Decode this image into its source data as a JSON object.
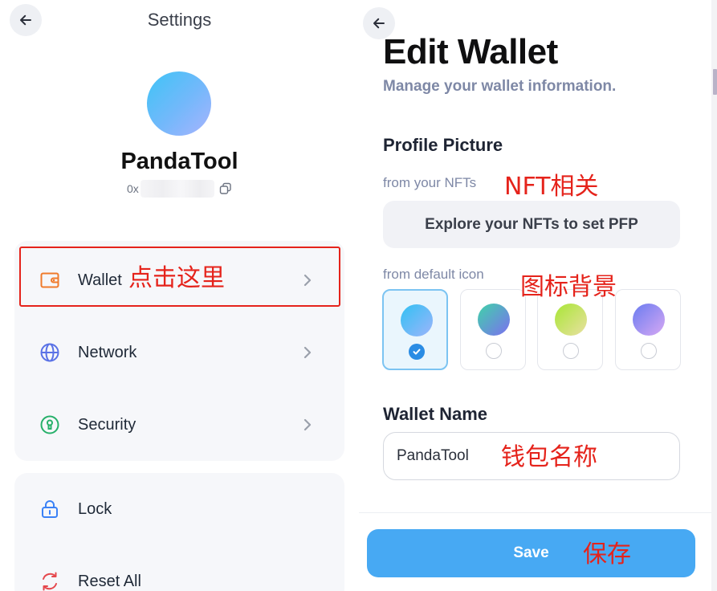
{
  "settings": {
    "title": "Settings",
    "profile": {
      "name": "PandaTool",
      "address_prefix": "0x"
    },
    "menu_group_1": [
      {
        "label": "Wallet",
        "icon": "wallet-icon"
      },
      {
        "label": "Network",
        "icon": "globe-icon"
      },
      {
        "label": "Security",
        "icon": "keyhole-icon"
      }
    ],
    "menu_group_2": [
      {
        "label": "Lock",
        "icon": "lock-icon"
      },
      {
        "label": "Reset All",
        "icon": "reset-icon"
      }
    ]
  },
  "edit_wallet": {
    "title": "Edit Wallet",
    "subtitle": "Manage your wallet information.",
    "profile_picture": {
      "heading": "Profile Picture",
      "from_nfts_label": "from your NFTs",
      "explore_button": "Explore your NFTs to set PFP",
      "from_default_label": "from default icon",
      "default_icons": [
        {
          "colors": [
            "#31c1f3",
            "#9db4fb"
          ],
          "selected": true
        },
        {
          "colors": [
            "#3fd3a8",
            "#7c6ff0"
          ],
          "selected": false
        },
        {
          "colors": [
            "#a8e635",
            "#e9e0a2"
          ],
          "selected": false
        },
        {
          "colors": [
            "#6a7cf0",
            "#d7a8f4"
          ],
          "selected": false
        }
      ]
    },
    "wallet_name": {
      "heading": "Wallet Name",
      "value": "PandaTool"
    },
    "save_button": "Save"
  },
  "annotations": {
    "wallet": "点击这里",
    "nft": "NFT相关",
    "icon_bg": "图标背景",
    "wallet_name": "钱包名称",
    "save": "保存"
  },
  "colors": {
    "accent": "#47a9f3",
    "annotation": "#e5231b",
    "wallet_icon": "#f07b2c",
    "network_icon": "#5a72e6",
    "security_icon": "#27b06a",
    "lock_icon": "#3b82f6",
    "reset_icon": "#e5484d"
  }
}
